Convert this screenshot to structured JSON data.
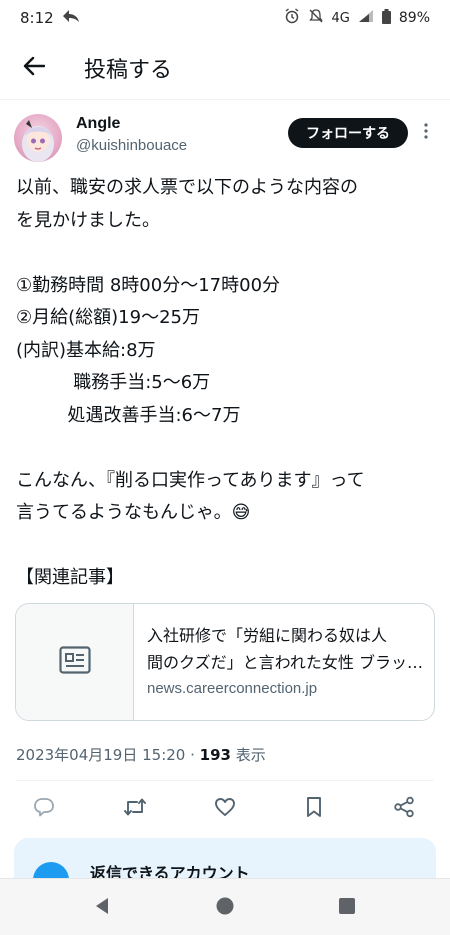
{
  "status_bar": {
    "time": "8:12",
    "network": "4G",
    "battery": "89%",
    "icons": [
      "share-arrow-icon",
      "alarm-icon",
      "mute-icon",
      "signal-icon",
      "battery-icon"
    ]
  },
  "header": {
    "title": "投稿する",
    "back_icon": "arrow-left-icon"
  },
  "author": {
    "name": "Angle",
    "handle": "@kuishinbouace",
    "follow_label": "フォローする",
    "more_icon": "more-vertical-icon"
  },
  "tweet": {
    "lines": [
      "以前、職安の求人票で以下のような内容の",
      "を見かけました。",
      "",
      "①勤務時間 8時00分〜17時00分",
      "②月給(総額)19〜25万",
      "(内訳)基本給:8万",
      "          職務手当:5〜6万",
      "         処遇改善手当:6〜7万",
      "",
      "こんなん、『削る口実作ってあります』って",
      "言うてるようなもんじゃ。😅",
      "",
      "【関連記事】"
    ]
  },
  "card": {
    "title_line1": "入社研修で「労組に関わる奴は人",
    "title_line2": "間のクズだ」と言われた女性 ブラック企業",
    "domain": "news.careerconnection.jp",
    "thumb_icon": "article-icon"
  },
  "meta": {
    "datetime": "2023年04月19日 15:20",
    "separator": " · ",
    "views_count": "193",
    "views_label": " 表示"
  },
  "actions": [
    "reply-icon",
    "retweet-icon",
    "like-icon",
    "bookmark-icon",
    "share-icon"
  ],
  "reply_panel": {
    "title": "返信できるアカウント"
  },
  "nav": [
    "back-triangle-icon",
    "home-circle-icon",
    "recents-square-icon"
  ],
  "colors": {
    "accent": "#1d9bf0",
    "text": "#0f1419",
    "secondary": "#536471",
    "follow_bg": "#0f1419"
  }
}
